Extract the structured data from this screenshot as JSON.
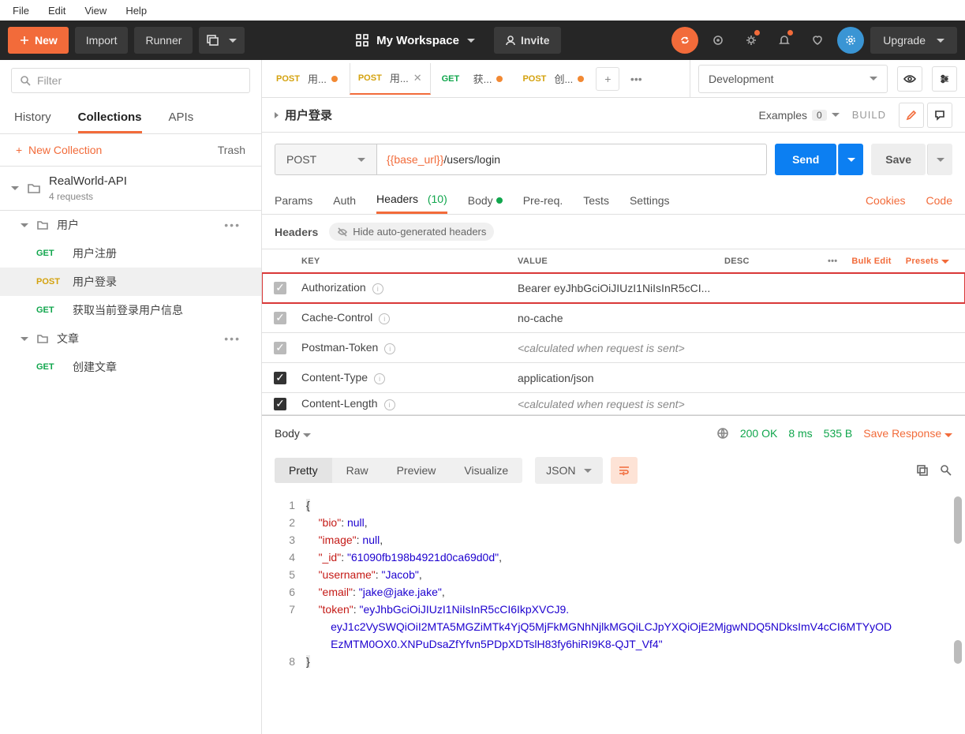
{
  "menu": {
    "file": "File",
    "edit": "Edit",
    "view": "View",
    "help": "Help"
  },
  "topbar": {
    "new": "New",
    "import": "Import",
    "runner": "Runner",
    "workspace": "My Workspace",
    "invite": "Invite",
    "upgrade": "Upgrade"
  },
  "sidebar": {
    "filter_ph": "Filter",
    "tabs": {
      "history": "History",
      "collections": "Collections",
      "apis": "APIs"
    },
    "new_collection": "New Collection",
    "trash": "Trash",
    "collection": {
      "name": "RealWorld-API",
      "sub": "4 requests"
    },
    "folders": [
      {
        "name": "用户",
        "items": [
          {
            "method": "GET",
            "name": "用户注册"
          },
          {
            "method": "POST",
            "name": "用户登录",
            "selected": true
          },
          {
            "method": "GET",
            "name": "获取当前登录用户信息"
          }
        ]
      },
      {
        "name": "文章",
        "items": [
          {
            "method": "GET",
            "name": "创建文章"
          }
        ]
      }
    ]
  },
  "tabs": [
    {
      "method": "POST",
      "label": "用...",
      "dot": true
    },
    {
      "method": "POST",
      "label": "用...",
      "dot": false,
      "close": true,
      "active": true
    },
    {
      "method": "GET",
      "label": "获...",
      "dot": true
    },
    {
      "method": "POST",
      "label": "创...",
      "dot": true
    }
  ],
  "env": {
    "name": "Development"
  },
  "crumb": {
    "name": "用户登录",
    "examples": "Examples",
    "ex_count": "0",
    "build": "BUILD"
  },
  "url": {
    "method": "POST",
    "var": "{{base_url}}",
    "path": "/users/login",
    "send": "Send",
    "save": "Save"
  },
  "reqtabs": {
    "params": "Params",
    "auth": "Auth",
    "headers": "Headers",
    "hcount": "(10)",
    "body": "Body",
    "prereq": "Pre-req.",
    "tests": "Tests",
    "settings": "Settings",
    "cookies": "Cookies",
    "code": "Code"
  },
  "hdrbar": {
    "title": "Headers",
    "hide": "Hide auto-generated headers"
  },
  "tblhead": {
    "key": "KEY",
    "value": "VALUE",
    "desc": "DESC",
    "bulk": "Bulk Edit",
    "presets": "Presets"
  },
  "headers": [
    {
      "k": "Authorization",
      "v": "Bearer eyJhbGciOiJIUzI1NiIsInR5cCI...",
      "gen": true,
      "hl": true
    },
    {
      "k": "Cache-Control",
      "v": "no-cache",
      "gen": true
    },
    {
      "k": "Postman-Token",
      "v": "<calculated when request is sent>",
      "gen": true,
      "calc": true
    },
    {
      "k": "Content-Type",
      "v": "application/json",
      "gen": false
    },
    {
      "k": "Content-Length",
      "v": "<calculated when request is sent>",
      "gen": false,
      "calc": true
    }
  ],
  "resp": {
    "body": "Body",
    "status": "200 OK",
    "time": "8 ms",
    "size": "535 B",
    "save": "Save Response"
  },
  "view": {
    "pretty": "Pretty",
    "raw": "Raw",
    "preview": "Preview",
    "visualize": "Visualize",
    "json": "JSON"
  },
  "json": {
    "bio_k": "\"bio\"",
    "bio_v": "null",
    "image_k": "\"image\"",
    "image_v": "null",
    "id_k": "\"_id\"",
    "id_v": "\"61090fb198b4921d0ca69d0d\"",
    "username_k": "\"username\"",
    "username_v": "\"Jacob\"",
    "email_k": "\"email\"",
    "email_v": "\"jake@jake.jake\"",
    "token_k": "\"token\"",
    "token_v1": "\"eyJhbGciOiJIUzI1NiIsInR5cCI6IkpXVCJ9.",
    "token_v2": "eyJ1c2VySWQiOiI2MTA5MGZiMTk4YjQ5MjFkMGNhNjlkMGQiLCJpYXQiOjE2MjgwNDQ5NDksImV4cCI6MTYyOD",
    "token_v3": "EzMTM0OX0.XNPuDsaZfYfvn5PDpXDTslH83fy6hiRI9K8-QJT_Vf4\""
  }
}
